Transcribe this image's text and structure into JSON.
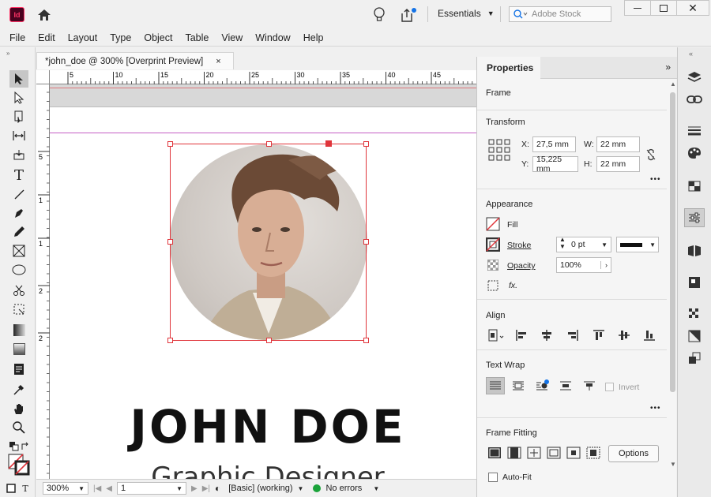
{
  "app": {
    "logo": "Id"
  },
  "workspace": {
    "label": "Essentials"
  },
  "search": {
    "placeholder": "Adobe Stock"
  },
  "menu": [
    "File",
    "Edit",
    "Layout",
    "Type",
    "Object",
    "Table",
    "View",
    "Window",
    "Help"
  ],
  "document": {
    "tab_title": "*john_doe @ 300% [Overprint Preview]",
    "close": "×"
  },
  "ruler": {
    "h_ticks": [
      "5",
      "10",
      "15",
      "20",
      "25",
      "30",
      "35",
      "40",
      "45",
      "5"
    ],
    "v_ticks": [
      "5",
      "1",
      "1",
      "2",
      "2"
    ]
  },
  "canvas": {
    "name": "JOHN DOE",
    "subtitle": "Graphic Designer"
  },
  "status": {
    "zoom": "300%",
    "page": "1",
    "style": "[Basic] (working)",
    "errors": "No errors"
  },
  "properties": {
    "tab": "Properties",
    "frame": "Frame",
    "transform": {
      "title": "Transform",
      "x_label": "X:",
      "x": "27,5 mm",
      "y_label": "Y:",
      "y": "15,225 mm",
      "w_label": "W:",
      "w": "22 mm",
      "h_label": "H:",
      "h": "22 mm"
    },
    "appearance": {
      "title": "Appearance",
      "fill": "Fill",
      "stroke": "Stroke",
      "stroke_value": "0 pt",
      "opacity": "Opacity",
      "opacity_value": "100%",
      "fx": "fx."
    },
    "align": {
      "title": "Align"
    },
    "text_wrap": {
      "title": "Text Wrap",
      "invert": "Invert"
    },
    "frame_fitting": {
      "title": "Frame Fitting",
      "options": "Options",
      "auto_fit": "Auto-Fit"
    },
    "more": "•••"
  },
  "colors": {
    "accent_red": "#e0353b",
    "guide": "#c35ec3",
    "status_ok": "#1aa33a",
    "notify": "#1473e6"
  }
}
